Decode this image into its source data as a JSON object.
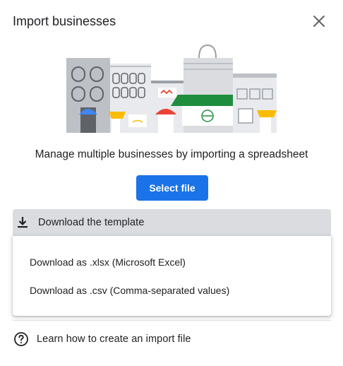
{
  "dialog": {
    "title": "Import businesses",
    "subtitle": "Manage multiple businesses by importing a spreadsheet",
    "select_file_label": "Select file",
    "template_label": "Download the template",
    "menu": [
      {
        "label": "Download as .xlsx (Microsoft Excel)"
      },
      {
        "label": "Download as .csv (Comma-separated values)"
      }
    ],
    "help_label": "Learn how to create an import file"
  },
  "icons": {
    "close": "close-icon",
    "download": "download-icon",
    "help": "help-circle-icon"
  },
  "colors": {
    "primary": "#1a73e8",
    "template_bar": "#dadce0",
    "awning_green": "#1e8e3e",
    "awning_yellow": "#fbbc04",
    "awning_red": "#ea4335",
    "awning_blue": "#4285f4"
  }
}
